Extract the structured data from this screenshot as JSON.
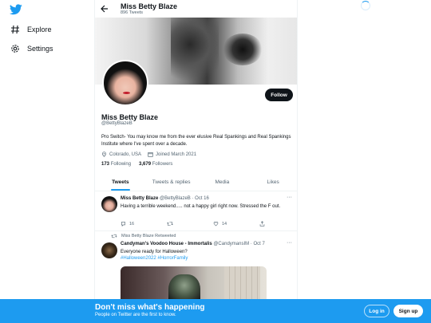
{
  "colors": {
    "brand": "#1d9bf0",
    "text": "#0f1419",
    "muted": "#536471"
  },
  "nav": {
    "logo_icon": "twitter-bird-icon",
    "items": [
      {
        "label": "Explore",
        "icon": "hashtag-icon"
      },
      {
        "label": "Settings",
        "icon": "gear-icon"
      }
    ]
  },
  "header": {
    "name": "Miss Betty Blaze",
    "tweet_count": "896 Tweets",
    "back_icon": "back-arrow-icon"
  },
  "profile": {
    "name": "Miss Betty Blaze",
    "handle": "@BettyBlazeB",
    "bio": "Pro Switch- You may know me from the ever elusive Real Spankings and Real Spankings Institute where I've spent over a decade.",
    "location": "Colorado, USA",
    "joined": "Joined March 2021",
    "following_count": "173",
    "following_label": "Following",
    "followers_count": "3,679",
    "followers_label": "Followers",
    "follow_button": "Follow"
  },
  "tabs": [
    {
      "label": "Tweets",
      "active": true
    },
    {
      "label": "Tweets & replies",
      "active": false
    },
    {
      "label": "Media",
      "active": false
    },
    {
      "label": "Likes",
      "active": false
    }
  ],
  "tweets": [
    {
      "name": "Miss Betty Blaze",
      "handle": "@BettyBlazeB",
      "date": "Oct 16",
      "text": "Having a terrible weekend.....  not a happy girl right now. Stressed the F out.",
      "reply_count": "16",
      "retweet_count": "",
      "like_count": "14"
    },
    {
      "retweeted_by": "Miss Betty Blaze Retweeted",
      "name": "Candyman's Voodoo House - Immortalis",
      "handle": "@CandymansIM",
      "date": "Oct 7",
      "text": "Everyone ready for Halloween?",
      "hashtags": "#Halloween2022 #HorrorFamily"
    }
  ],
  "bottom_bar": {
    "title": "Don't miss what's happening",
    "subtitle": "People on Twitter are the first to know.",
    "login": "Log in",
    "signup": "Sign up"
  }
}
